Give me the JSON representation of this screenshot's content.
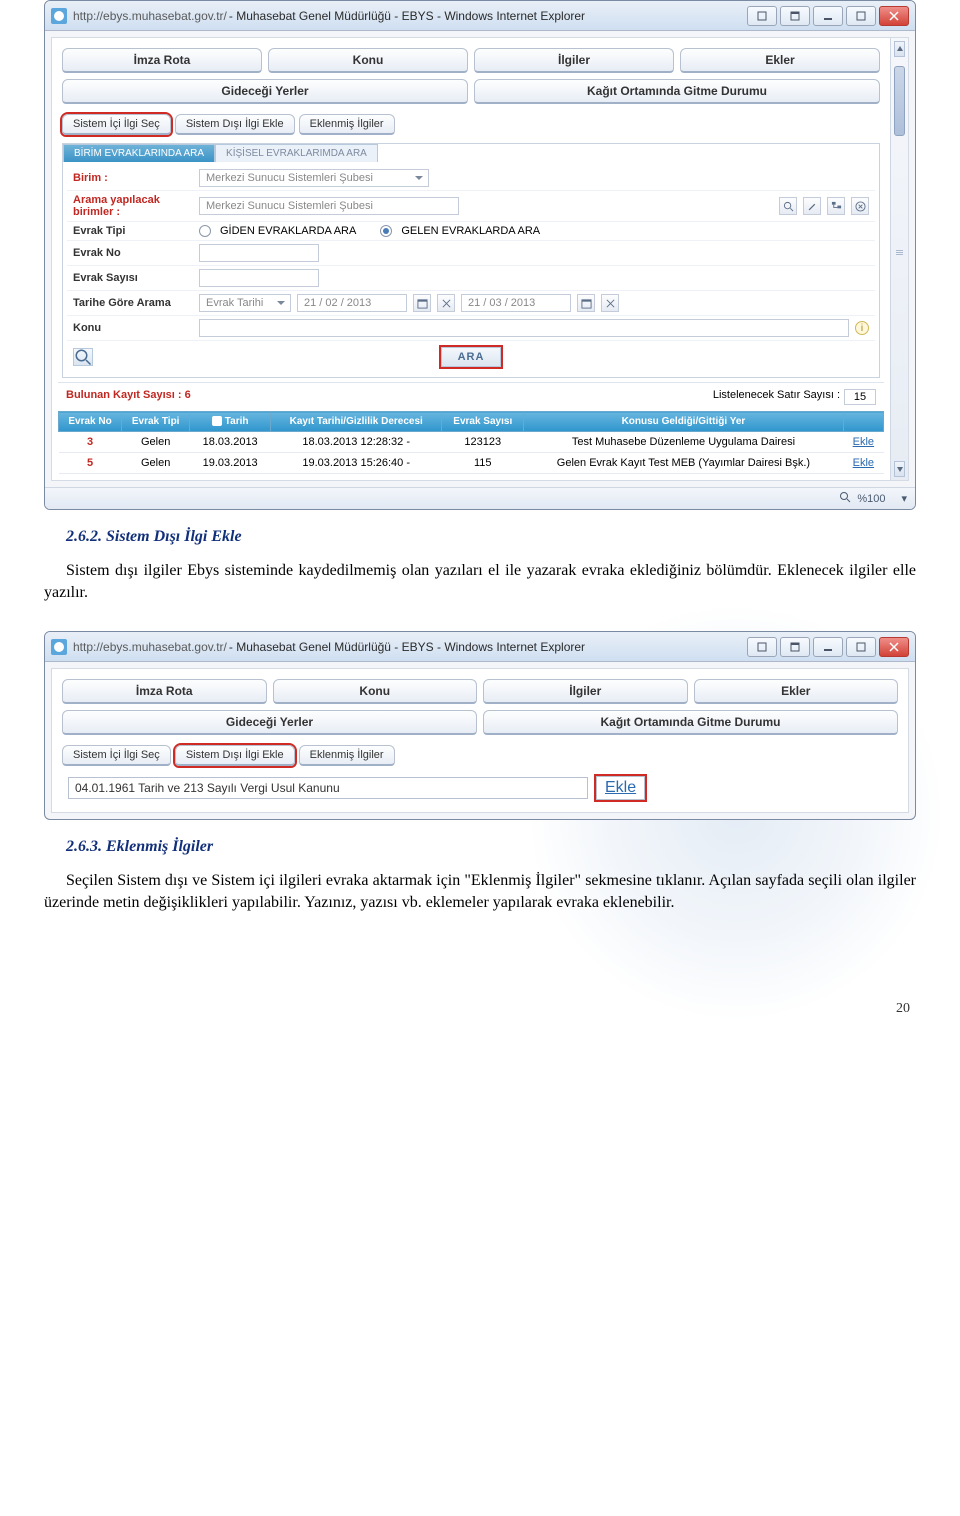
{
  "browser1": {
    "url": "http://ebys.muhasebat.gov.tr/",
    "title": " - Muhasebat Genel Müdürlüğü - EBYS - Windows Internet Explorer",
    "tabs": [
      "İmza Rota",
      "Konu",
      "İlgiler",
      "Ekler"
    ],
    "secondTabs": [
      "Gideceği Yerler",
      "Kağıt Ortamında Gitme Durumu"
    ],
    "subTabs": [
      "Sistem İçi İlgi Seç",
      "Sistem Dışı İlgi Ekle",
      "Eklenmiş İlgiler"
    ],
    "searchPanel": {
      "tabActive": "BİRİM EVRAKLARINDA ARA",
      "tabInactive": "KİŞİSEL EVRAKLARIMDA ARA",
      "birimLabel": "Birim :",
      "birimValue": "Merkezi Sunucu Sistemleri Şubesi",
      "aramaLabel": "Arama yapılacak birimler :",
      "aramaValue": "Merkezi Sunucu Sistemleri Şubesi",
      "evrakTipiLabel": "Evrak Tipi",
      "radioGiden": "GİDEN EVRAKLARDA ARA",
      "radioGelen": "GELEN EVRAKLARDA ARA",
      "evrakNoLabel": "Evrak No",
      "evrakSayisiLabel": "Evrak Sayısı",
      "tariheGoreLabel": "Tarihe Göre Arama",
      "tariheGoreDd": "Evrak Tarihi",
      "dateFrom": "21 / 02 / 2013",
      "dateTo": "21 / 03 / 2013",
      "konuLabel": "Konu",
      "araBtn": "ARA"
    },
    "results": {
      "foundLabel": "Bulunan Kayıt Sayısı : 6",
      "listLabel": "Listelenecek Satır Sayısı :",
      "listValue": "15",
      "headers": [
        "Evrak No",
        "Evrak Tipi",
        "Tarih",
        "Kayıt Tarihi/Gizlilik Derecesi",
        "Evrak Sayısı",
        "Konusu Geldiği/Gittiği Yer",
        ""
      ],
      "rows": [
        {
          "no": "3",
          "tipi": "Gelen",
          "tarih": "18.03.2013",
          "kayit": "18.03.2013 12:28:32 -",
          "sayisi": "123123",
          "konu": "Test Muhasebe Düzenleme Uygulama Dairesi",
          "action": "Ekle"
        },
        {
          "no": "5",
          "tipi": "Gelen",
          "tarih": "19.03.2013",
          "kayit": "19.03.2013 15:26:40 -",
          "sayisi": "115",
          "konu": "Gelen Evrak Kayıt Test MEB (Yayımlar Dairesi Bşk.)",
          "action": "Ekle"
        }
      ]
    },
    "zoom": "%100"
  },
  "section262": {
    "heading": "2.6.2.   Sistem Dışı İlgi Ekle",
    "body": "Sistem dışı ilgiler Ebys sisteminde kaydedilmemiş olan yazıları el ile yazarak evraka eklediğiniz bölümdür. Eklenecek ilgiler elle yazılır."
  },
  "browser2": {
    "url": "http://ebys.muhasebat.gov.tr/",
    "title": " - Muhasebat Genel Müdürlüğü - EBYS - Windows Internet Explorer",
    "tabs": [
      "İmza Rota",
      "Konu",
      "İlgiler",
      "Ekler"
    ],
    "secondTabs": [
      "Gideceği Yerler",
      "Kağıt Ortamında Gitme Durumu"
    ],
    "subTabs": [
      "Sistem İçi İlgi Seç",
      "Sistem Dışı İlgi Ekle",
      "Eklenmiş İlgiler"
    ],
    "ilgiValue": "04.01.1961 Tarih ve 213 Sayılı Vergi Usul Kanunu",
    "ekle": "Ekle"
  },
  "section263": {
    "heading": "2.6.3.   Eklenmiş İlgiler",
    "body": "Seçilen Sistem dışı ve Sistem içi ilgileri evraka aktarmak için \"Eklenmiş İlgiler\" sekmesine tıklanır. Açılan sayfada seçili olan ilgiler üzerinde metin değişiklikleri yapılabilir. Yazınız, yazısı vb. eklemeler yapılarak evraka eklenebilir."
  },
  "pageNumber": "20"
}
